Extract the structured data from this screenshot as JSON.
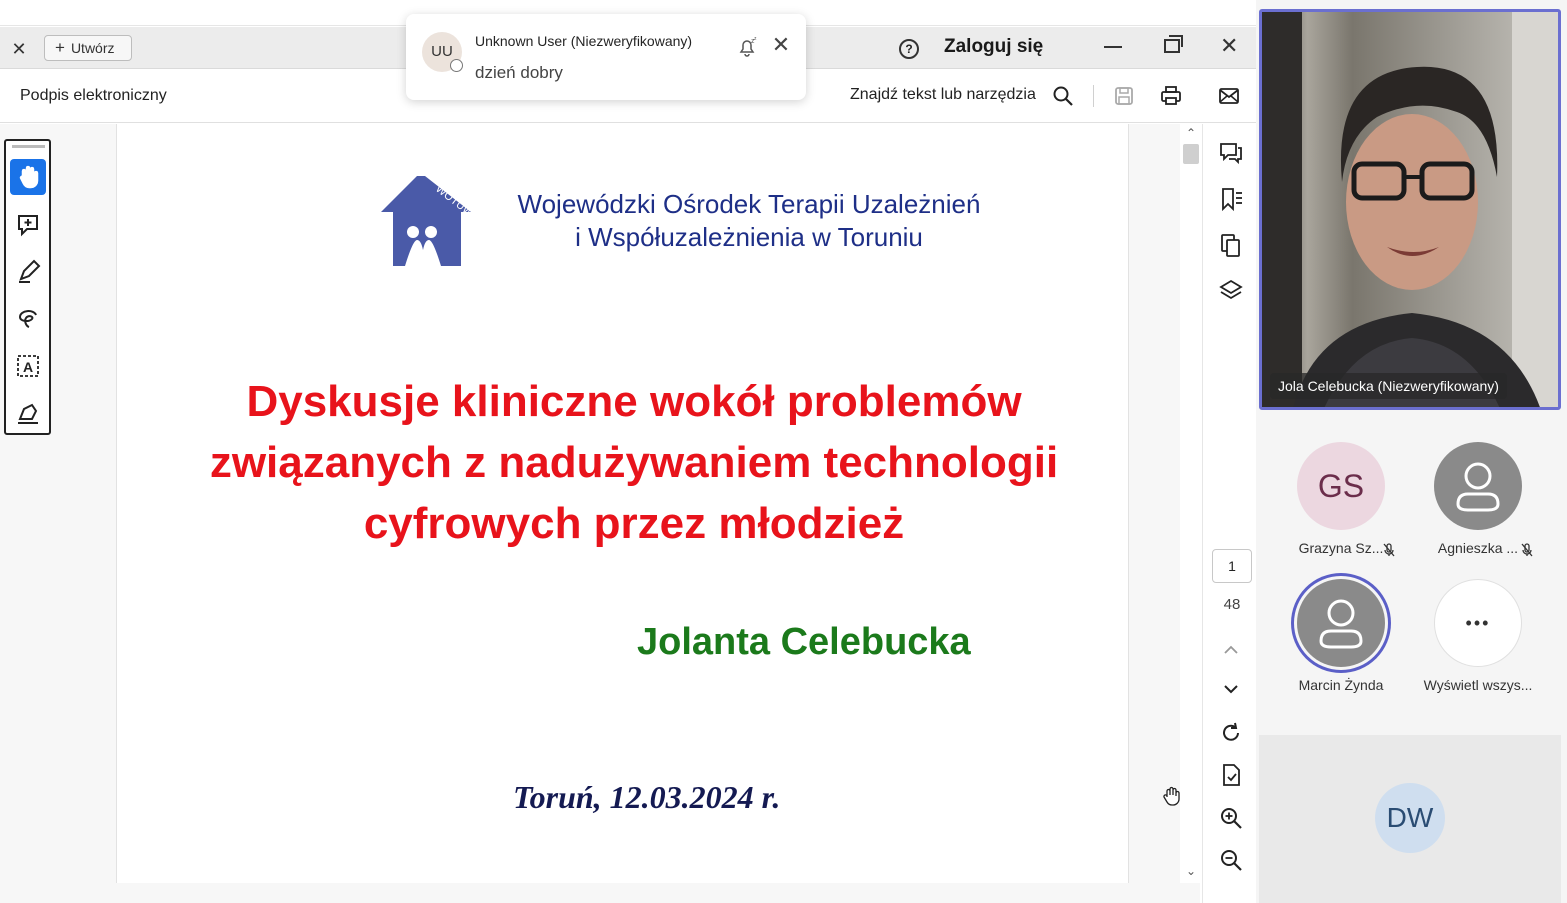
{
  "viewer": {
    "tab_close_glyph": "✕",
    "create_button_label": "Utwórz",
    "help_glyph": "?",
    "login_label": "Zaloguj się",
    "close_glyph": "✕",
    "esign_label": "Podpis elektroniczny",
    "find_label": "Znajdź tekst lub narzędzia"
  },
  "notification": {
    "initials": "UU",
    "sender": "Unknown User (Niezweryfikowany)",
    "message": "dzień dobry",
    "close_glyph": "✕"
  },
  "document": {
    "org_line1": "Wojewódzki Ośrodek Terapii Uzależnień",
    "org_line2": "i Współuzależnienia w Toruniu",
    "logo_text": "WOTUW",
    "title_line1": "Dyskusje kliniczne wokół problemów",
    "title_line2": "związanych z nadużywaniem technologii",
    "title_line3": "cyfrowych przez młodzież",
    "author": "Jolanta Celebucka",
    "date": "Toruń, 12.03.2024 r.",
    "current_page": "1",
    "total_pages": "48"
  },
  "participants": {
    "video_label": "Jola Celebucka (Niezweryfikowany)",
    "people": [
      {
        "initials": "GS",
        "name": "Grazyna Sz..."
      },
      {
        "initials": "",
        "name": "Agnieszka ..."
      },
      {
        "initials": "",
        "name": "Marcin Żynda"
      },
      {
        "initials": "",
        "name": "Wyświetl wszys..."
      }
    ],
    "more_glyph": "•••",
    "bottom_initials": "DW"
  },
  "colors": {
    "title_red": "#e8131b",
    "author_green": "#1b7a1b",
    "org_blue": "#1e2f87",
    "speaker_border": "#6b6fd0"
  }
}
